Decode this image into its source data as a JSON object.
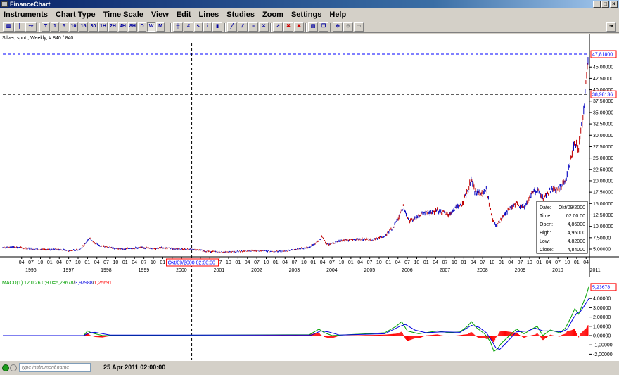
{
  "window": {
    "title": "FinanceChart"
  },
  "menu": [
    "Instruments",
    "Chart Type",
    "Time Scale",
    "View",
    "Edit",
    "Lines",
    "Studies",
    "Zoom",
    "Settings",
    "Help"
  ],
  "toolbar": {
    "timeframes": [
      "T",
      "1",
      "5",
      "10",
      "15",
      "30",
      "1H",
      "2H",
      "4H",
      "8H",
      "D",
      "W",
      "M"
    ]
  },
  "chart": {
    "header": "Silver, spot , Weekly, # 840 / 840",
    "price_axis": [
      "47,81800",
      "45,00000",
      "42,50000",
      "40,00000",
      "38,98136",
      "37,50000",
      "35,00000",
      "32,50000",
      "30,00000",
      "27,50000",
      "25,00000",
      "22,50000",
      "20,00000",
      "17,50000",
      "15,00000",
      "12,50000",
      "10,00000",
      "7,50000",
      "5,00000"
    ],
    "top_marker": "47,81800",
    "crosshair_price": "38,98136",
    "crosshair_time": "Okt/09/2000 02:00:00",
    "month_ticks": [
      "04",
      "07",
      "10",
      "01",
      "04",
      "07",
      "10",
      "01",
      "04",
      "07",
      "10",
      "01",
      "04",
      "07",
      "10",
      "01",
      "04",
      "07",
      "10",
      "01",
      "04",
      "07",
      "10",
      "01",
      "04",
      "07",
      "10",
      "01",
      "04",
      "07",
      "10",
      "01",
      "04",
      "07",
      "10",
      "01",
      "04",
      "07",
      "10",
      "01",
      "04",
      "07",
      "10",
      "01",
      "04",
      "07",
      "10",
      "01",
      "04",
      "07",
      "10",
      "01",
      "04",
      "07",
      "10",
      "01",
      "04",
      "07",
      "10",
      "01",
      "04"
    ],
    "year_labels": [
      "1996",
      "1997",
      "1998",
      "1999",
      "2000",
      "2001",
      "2002",
      "2003",
      "2004",
      "2005",
      "2006",
      "2007",
      "2008",
      "2009",
      "2010",
      "2011"
    ],
    "tooltip": {
      "date_label": "Date:",
      "date": "Okt/09/2000",
      "time_label": "Time:",
      "time": "02:00:00",
      "open_label": "Open:",
      "open": "4,86000",
      "high_label": "High:",
      "high": "4,95000",
      "low_label": "Low:",
      "low": "4,82000",
      "close_label": "Close:",
      "close": "4,84000"
    }
  },
  "macd": {
    "header_prefix": "MACD(1) 12.0;26.0;9.0=",
    "header_v1": "5,23678",
    "header_v2": "3,97988",
    "header_v3": "1,25691",
    "axis": [
      "5,23678",
      "4,00000",
      "3,00000",
      "2,00000",
      "1,00000",
      "0,00000",
      "-1,00000",
      "-2,00000"
    ],
    "colors": {
      "macd": "#00a000",
      "signal": "#0000e0",
      "hist": "#ff0000"
    }
  },
  "status": {
    "instrument_placeholder": "type instrument name",
    "datetime": "25 Apr 2011 02:00:00"
  },
  "chart_data": {
    "type": "line",
    "title": "Silver, spot , Weekly",
    "x_start_year": 1995.75,
    "x_end_year": 2011.32,
    "ylim": [
      3.0,
      48.8
    ],
    "series": [
      {
        "values": [
          [
            1995.75,
            5.3
          ],
          [
            1996.0,
            5.5
          ],
          [
            1996.3,
            5.2
          ],
          [
            1996.6,
            5.0
          ],
          [
            1996.9,
            4.8
          ],
          [
            1997.2,
            5.0
          ],
          [
            1997.5,
            4.6
          ],
          [
            1997.8,
            4.9
          ],
          [
            1997.95,
            6.2
          ],
          [
            1998.05,
            7.5
          ],
          [
            1998.2,
            6.3
          ],
          [
            1998.4,
            5.6
          ],
          [
            1998.7,
            5.2
          ],
          [
            1998.9,
            5.0
          ],
          [
            1999.2,
            5.2
          ],
          [
            1999.5,
            5.3
          ],
          [
            1999.8,
            5.1
          ],
          [
            2000.0,
            5.3
          ],
          [
            2000.4,
            5.0
          ],
          [
            2000.8,
            4.9
          ],
          [
            2001.2,
            4.5
          ],
          [
            2001.6,
            4.3
          ],
          [
            2001.9,
            4.4
          ],
          [
            2002.3,
            4.6
          ],
          [
            2002.6,
            4.6
          ],
          [
            2002.9,
            4.5
          ],
          [
            2003.3,
            4.6
          ],
          [
            2003.6,
            5.0
          ],
          [
            2003.9,
            5.4
          ],
          [
            2004.1,
            6.5
          ],
          [
            2004.25,
            7.8
          ],
          [
            2004.35,
            6.0
          ],
          [
            2004.6,
            6.5
          ],
          [
            2004.9,
            7.0
          ],
          [
            2005.3,
            7.2
          ],
          [
            2005.6,
            7.0
          ],
          [
            2005.9,
            8.0
          ],
          [
            2006.1,
            9.5
          ],
          [
            2006.3,
            12.5
          ],
          [
            2006.4,
            14.5
          ],
          [
            2006.55,
            11.0
          ],
          [
            2006.8,
            12.5
          ],
          [
            2007.0,
            13.0
          ],
          [
            2007.3,
            13.5
          ],
          [
            2007.6,
            12.5
          ],
          [
            2007.8,
            14.0
          ],
          [
            2007.95,
            15.0
          ],
          [
            2008.1,
            17.5
          ],
          [
            2008.2,
            20.5
          ],
          [
            2008.3,
            17.5
          ],
          [
            2008.5,
            17.0
          ],
          [
            2008.6,
            18.0
          ],
          [
            2008.75,
            12.0
          ],
          [
            2008.85,
            10.0
          ],
          [
            2008.95,
            11.0
          ],
          [
            2009.1,
            13.0
          ],
          [
            2009.4,
            15.0
          ],
          [
            2009.6,
            14.0
          ],
          [
            2009.8,
            17.0
          ],
          [
            2009.95,
            18.0
          ],
          [
            2010.1,
            16.0
          ],
          [
            2010.3,
            18.0
          ],
          [
            2010.5,
            18.0
          ],
          [
            2010.7,
            20.0
          ],
          [
            2010.8,
            23.0
          ],
          [
            2010.95,
            29.0
          ],
          [
            2011.05,
            27.0
          ],
          [
            2011.1,
            30.0
          ],
          [
            2011.2,
            37.0
          ],
          [
            2011.28,
            44.0
          ],
          [
            2011.32,
            47.8
          ]
        ]
      },
      {
        "name": "MACD",
        "values": [
          [
            1995.75,
            0.0
          ],
          [
            1997.9,
            0.0
          ],
          [
            1998.0,
            0.5
          ],
          [
            1998.1,
            0.3
          ],
          [
            1998.4,
            0.0
          ],
          [
            2003.9,
            0.1
          ],
          [
            2004.15,
            0.7
          ],
          [
            2004.3,
            0.3
          ],
          [
            2004.5,
            0.0
          ],
          [
            2005.9,
            0.3
          ],
          [
            2006.2,
            1.0
          ],
          [
            2006.35,
            1.5
          ],
          [
            2006.5,
            0.5
          ],
          [
            2006.8,
            0.2
          ],
          [
            2007.3,
            0.5
          ],
          [
            2007.6,
            0.3
          ],
          [
            2007.9,
            0.4
          ],
          [
            2008.1,
            1.0
          ],
          [
            2008.2,
            1.5
          ],
          [
            2008.35,
            0.8
          ],
          [
            2008.55,
            0.2
          ],
          [
            2008.7,
            -0.6
          ],
          [
            2008.8,
            -1.7
          ],
          [
            2008.9,
            -1.4
          ],
          [
            2009.0,
            -0.8
          ],
          [
            2009.4,
            0.7
          ],
          [
            2009.6,
            0.2
          ],
          [
            2009.85,
            0.8
          ],
          [
            2009.95,
            1.0
          ],
          [
            2010.1,
            0.0
          ],
          [
            2010.3,
            0.6
          ],
          [
            2010.55,
            0.3
          ],
          [
            2010.7,
            0.8
          ],
          [
            2010.85,
            2.0
          ],
          [
            2010.95,
            2.9
          ],
          [
            2011.05,
            2.3
          ],
          [
            2011.15,
            3.3
          ],
          [
            2011.25,
            4.3
          ],
          [
            2011.32,
            5.24
          ]
        ]
      },
      {
        "name": "Signal",
        "values": [
          [
            1995.75,
            0.0
          ],
          [
            1997.9,
            0.0
          ],
          [
            1998.05,
            0.3
          ],
          [
            1998.2,
            0.35
          ],
          [
            1998.6,
            0.05
          ],
          [
            2003.95,
            0.05
          ],
          [
            2004.2,
            0.5
          ],
          [
            2004.4,
            0.4
          ],
          [
            2004.7,
            0.05
          ],
          [
            2005.9,
            0.2
          ],
          [
            2006.3,
            1.0
          ],
          [
            2006.45,
            1.2
          ],
          [
            2006.7,
            0.6
          ],
          [
            2007.0,
            0.3
          ],
          [
            2007.4,
            0.4
          ],
          [
            2007.9,
            0.35
          ],
          [
            2008.2,
            1.1
          ],
          [
            2008.4,
            0.9
          ],
          [
            2008.6,
            0.3
          ],
          [
            2008.75,
            -0.6
          ],
          [
            2008.85,
            -1.3
          ],
          [
            2008.95,
            -1.5
          ],
          [
            2009.1,
            -0.9
          ],
          [
            2009.4,
            0.4
          ],
          [
            2009.7,
            0.5
          ],
          [
            2009.9,
            0.8
          ],
          [
            2010.1,
            0.5
          ],
          [
            2010.35,
            0.5
          ],
          [
            2010.6,
            0.4
          ],
          [
            2010.75,
            0.7
          ],
          [
            2010.9,
            1.8
          ],
          [
            2011.0,
            2.4
          ],
          [
            2011.1,
            2.6
          ],
          [
            2011.2,
            3.2
          ],
          [
            2011.32,
            3.98
          ]
        ]
      }
    ]
  }
}
